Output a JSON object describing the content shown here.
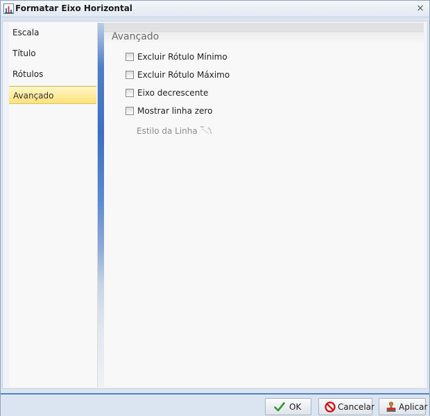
{
  "window": {
    "title": "Formatar Eixo Horizontal",
    "close_glyph": "×"
  },
  "nav": {
    "items": [
      {
        "label": "Escala",
        "selected": false
      },
      {
        "label": "Título",
        "selected": false
      },
      {
        "label": "Rótulos",
        "selected": false
      },
      {
        "label": "Avançado",
        "selected": true
      }
    ]
  },
  "panel": {
    "title": "Avançado",
    "options": [
      {
        "label": "Excluir Rótulo Mínimo",
        "checked": false
      },
      {
        "label": "Excluir Rótulo Máximo",
        "checked": false
      },
      {
        "label": "Eixo decrescente",
        "checked": false
      },
      {
        "label": "Mostrar linha zero",
        "checked": false
      }
    ],
    "line_style_label": "Estilo da Linha",
    "line_style_icon": "line-style-picker-icon",
    "line_style_enabled": false
  },
  "footer": {
    "ok_label": "OK",
    "cancel_label": "Cancelar",
    "apply_label": "Aplicar"
  },
  "colors": {
    "selected_item": "#ffe27a",
    "accent_border": "#4e84c9",
    "ok_check": "#2e9a2e",
    "cancel_red": "#d0161b"
  }
}
